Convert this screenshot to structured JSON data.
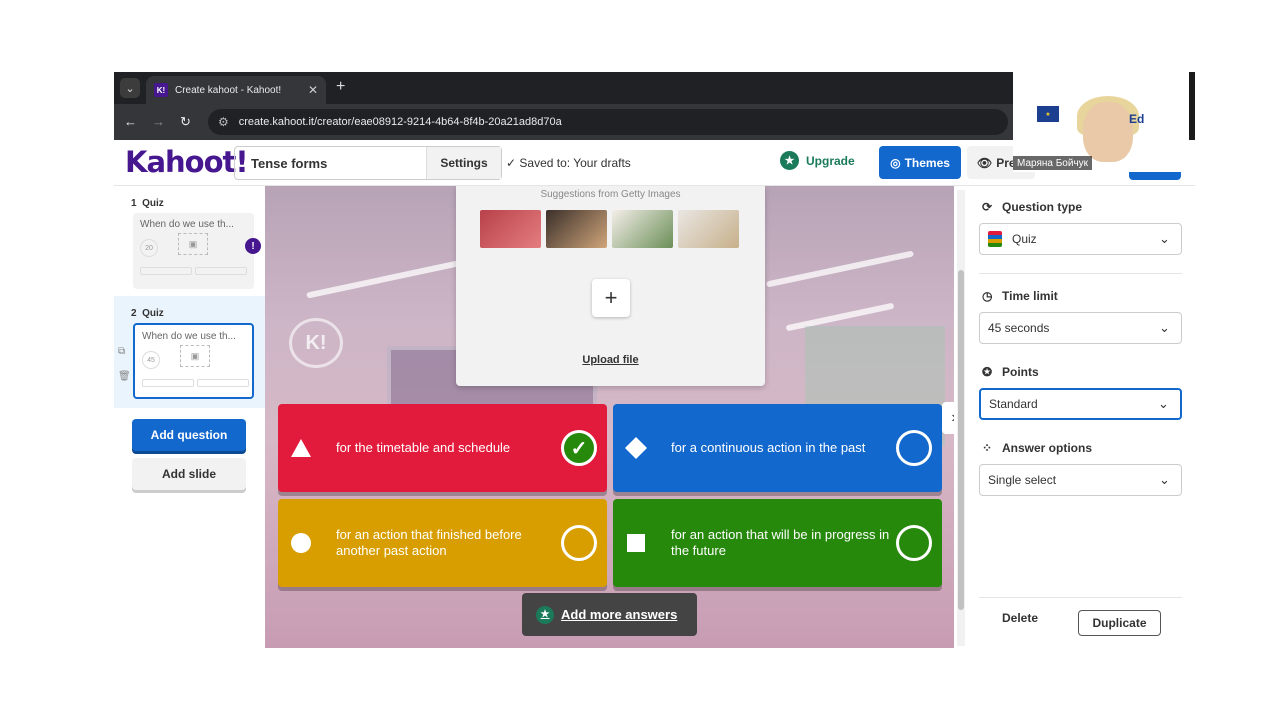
{
  "browser": {
    "tab_title": "Create kahoot - Kahoot!",
    "favicon": "K!",
    "url": "create.kahoot.it/creator/eae08912-9214-4b64-8f4b-20a21ad8d70a"
  },
  "header": {
    "logo": "Kahoot!",
    "kahoot_title": "Tense forms",
    "settings_label": "Settings",
    "saved_status": "Saved to: Your drafts",
    "upgrade_label": "Upgrade",
    "themes_label": "Themes",
    "preview_label": "Pre"
  },
  "sidebar": {
    "slides": [
      {
        "number": "1",
        "type": "Quiz",
        "question": "When do we use th...",
        "time": "20"
      },
      {
        "number": "2",
        "type": "Quiz",
        "question": "When do we use th...",
        "time": "45"
      }
    ],
    "warning_icon": "!",
    "add_question_label": "Add question",
    "add_slide_label": "Add slide"
  },
  "media": {
    "suggestions_title": "Suggestions from Getty Images",
    "upload_label": "Upload file",
    "plus_icon": "+"
  },
  "answers": [
    {
      "shape": "triangle",
      "text": "for the timetable and schedule",
      "color": "#e21b3c",
      "correct": true
    },
    {
      "shape": "diamond",
      "text": "for a continuous action in the past",
      "color": "#1368ce",
      "correct": false
    },
    {
      "shape": "circle",
      "text": "for an action that finished before another past action",
      "color": "#d89e00",
      "correct": false
    },
    {
      "shape": "square",
      "text": "for an action that will be in progress in the future",
      "color": "#26890c",
      "correct": false
    }
  ],
  "add_more_answers_label": "Add more answers",
  "right_panel": {
    "question_type_label": "Question type",
    "question_type_value": "Quiz",
    "time_limit_label": "Time limit",
    "time_limit_value": "45 seconds",
    "points_label": "Points",
    "points_value": "Standard",
    "answer_options_label": "Answer options",
    "answer_options_value": "Single select",
    "delete_label": "Delete",
    "duplicate_label": "Duplicate"
  },
  "webcam": {
    "participant_name": "Маряна Бойчук",
    "logo_text": "Ed"
  },
  "colors": {
    "kahoot_purple": "#46178f",
    "primary_blue": "#1368ce",
    "upgrade_green": "#1a7a5a"
  }
}
